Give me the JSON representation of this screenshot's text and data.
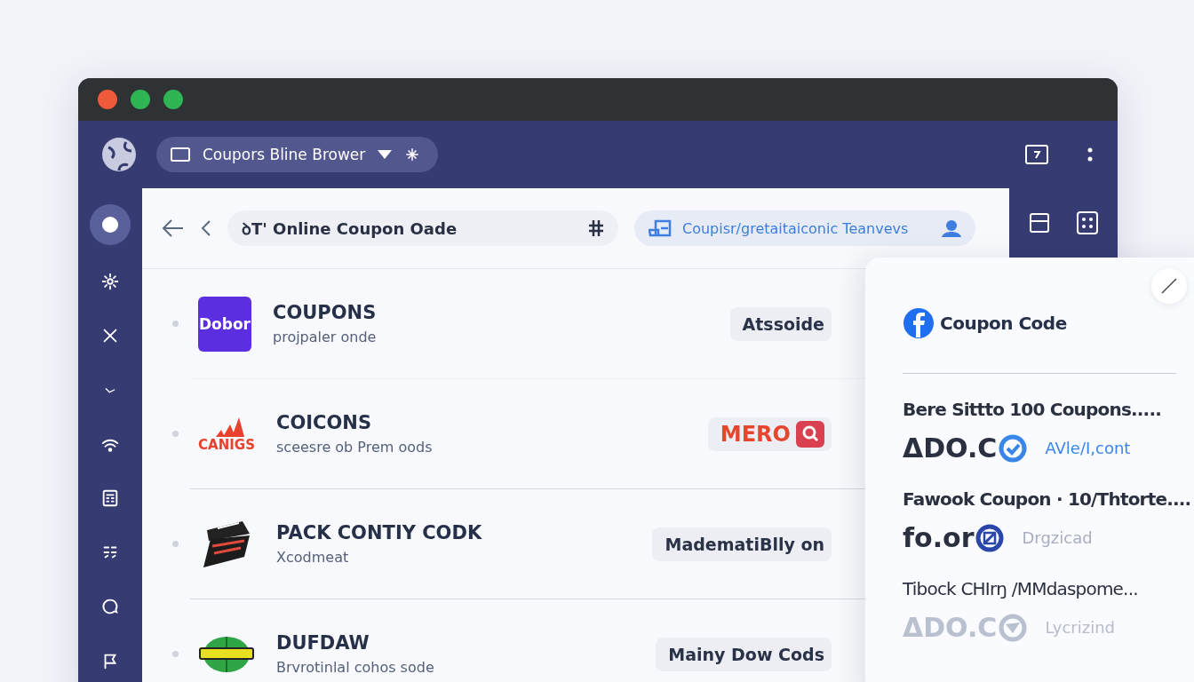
{
  "window": {
    "traffic_lights": [
      {
        "color": "#ee5a3a"
      },
      {
        "color": "#2fb553"
      },
      {
        "color": "#2fb553"
      }
    ]
  },
  "header": {
    "tab_title": "Coupors Bline Brower"
  },
  "sidebar": {
    "items": [
      {
        "selected": true
      },
      {
        "selected": false
      },
      {
        "selected": false
      },
      {
        "selected": false
      },
      {
        "selected": false
      },
      {
        "selected": false
      },
      {
        "selected": false
      },
      {
        "selected": false
      },
      {
        "selected": false
      }
    ]
  },
  "address_bar": {
    "title": "Online Coupon Oade",
    "prefix": "ꝺT'",
    "url": "Coupisr/gretaitaiconic Teanvevs"
  },
  "rows": [
    {
      "logo": {
        "kind": "square",
        "text": "Dobor"
      },
      "title": "COUPONS",
      "subtitle": "projpaler onde",
      "badge": {
        "kind": "plain",
        "text": "Atssoide"
      }
    },
    {
      "logo": {
        "kind": "stripes",
        "text": "CANIGS"
      },
      "title": "COICONS",
      "subtitle": "sceesre ob Prem oods",
      "badge": {
        "kind": "brand",
        "text": "MERO"
      }
    },
    {
      "logo": {
        "kind": "emblem"
      },
      "title": "PACK CONTIY CODK",
      "subtitle": "Xcodmeat",
      "badge": {
        "kind": "plain",
        "text": "MadematiBlly on"
      }
    },
    {
      "logo": {
        "kind": "ball"
      },
      "title": "DUFDAW",
      "subtitle": "Brvrotinlal cohos sode",
      "badge": {
        "kind": "plain",
        "text": "Mainy Dow Cods"
      }
    }
  ],
  "panel": {
    "title": "Coupon Code",
    "entries": [
      {
        "heading": "Bere Sittto 100 Coupons.....",
        "logo": {
          "kind": "check",
          "text": "ΔDO.C"
        },
        "note": "AVle/I,cont",
        "faded": false
      },
      {
        "heading": "Fawook Coupon · 10/Thtorte....",
        "logo": {
          "kind": "edit",
          "text": "fo.or"
        },
        "note": "Drgzicad",
        "faded": false
      },
      {
        "heading": "Tibock CHIrŋ /MMdaspome...",
        "logo": {
          "kind": "send",
          "text": "ΔDO.C"
        },
        "note": "Lycrizind",
        "faded": true
      }
    ]
  }
}
